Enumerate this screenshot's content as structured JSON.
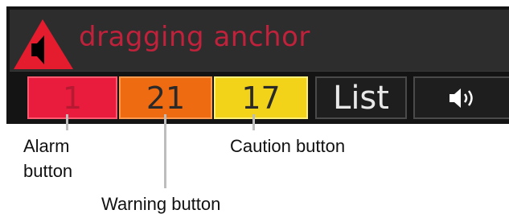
{
  "alert": {
    "message": "dragging anchor",
    "icon": "alarm-triangle-speaker-icon",
    "message_color": "#c0213b"
  },
  "buttons": {
    "alarm": {
      "count": "1",
      "color": "#ea1c3d"
    },
    "warning": {
      "count": "21",
      "color": "#ef6b12"
    },
    "caution": {
      "count": "17",
      "color": "#f3d31a"
    },
    "list": {
      "label": "List"
    },
    "sound": {
      "icon": "speaker-sound-icon"
    }
  },
  "callouts": {
    "alarm_line1": "Alarm",
    "alarm_line2": "button",
    "caution": "Caution button",
    "warning": "Warning button"
  }
}
